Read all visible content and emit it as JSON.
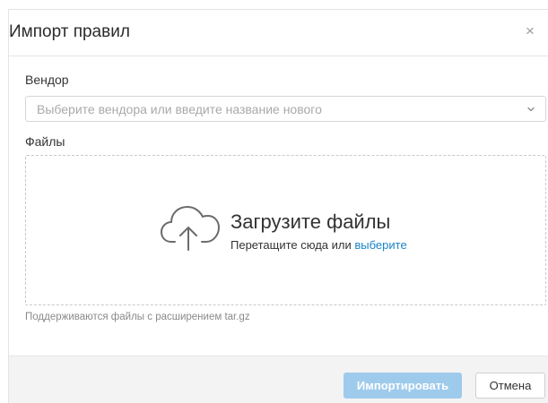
{
  "dialog": {
    "title": "Импорт правил",
    "close_icon": "close-icon",
    "close_glyph": "×"
  },
  "vendor": {
    "label": "Вендор",
    "placeholder": "Выберите вендора или введите название нового",
    "arrow_icon": "chevron-down-icon"
  },
  "files": {
    "label": "Файлы",
    "upload_icon": "cloud-upload-icon",
    "drop_title": "Загрузите файлы",
    "drop_text": "Перетащите сюда или",
    "drop_link": "выберите",
    "hint": "Поддерживаются файлы с расширением tar.gz"
  },
  "footer": {
    "import_label": "Импортировать",
    "cancel_label": "Отмена"
  },
  "colors": {
    "accent_link": "#1a85c9",
    "primary_button_disabled": "#9ecbec",
    "footer_bg": "#f3f3f3"
  }
}
